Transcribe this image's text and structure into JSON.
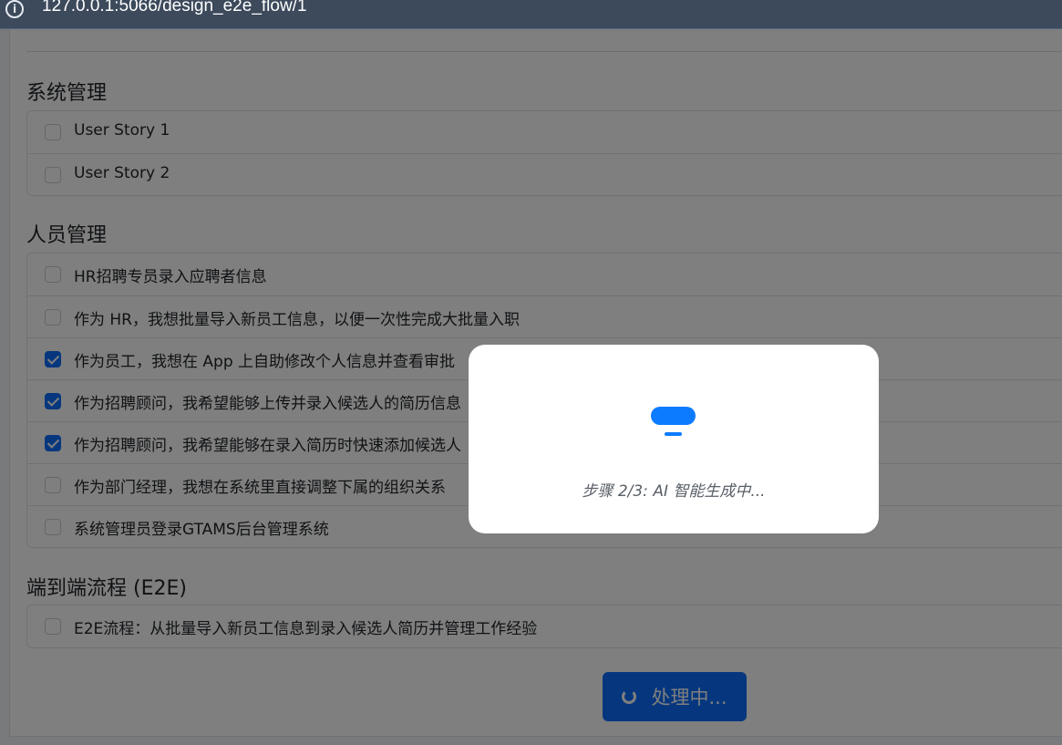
{
  "browser": {
    "url": "127.0.0.1:5066/design_e2e_flow/1"
  },
  "sections": [
    {
      "title": "系统管理",
      "items": [
        {
          "label": "User Story 1",
          "checked": false
        },
        {
          "label": "User Story 2",
          "checked": false
        }
      ]
    },
    {
      "title": "人员管理",
      "items": [
        {
          "label": "HR招聘专员录入应聘者信息",
          "checked": false
        },
        {
          "label": "作为 HR，我想批量导入新员工信息，以便一次性完成大批量入职",
          "checked": false
        },
        {
          "label": "作为员工，我想在 App 上自助修改个人信息并查看审批",
          "checked": true
        },
        {
          "label": "作为招聘顾问，我希望能够上传并录入候选人的简历信息",
          "checked": true
        },
        {
          "label": "作为招聘顾问，我希望能够在录入简历时快速添加候选人",
          "checked": true
        },
        {
          "label": "作为部门经理，我想在系统里直接调整下属的组织关系",
          "checked": false
        },
        {
          "label": "系统管理员登录GTAMS后台管理系统",
          "checked": false
        }
      ]
    },
    {
      "title": "端到端流程 (E2E)",
      "items": [
        {
          "label": "E2E流程：从批量导入新员工信息到录入候选人简历并管理工作经验",
          "checked": false
        }
      ]
    }
  ],
  "submit_button": {
    "label": "处理中..."
  },
  "modal": {
    "status_text": "步骤 2/3: AI 智能生成中..."
  },
  "colors": {
    "primary": "#0d6efd",
    "overlay": "rgba(0,0,0,0.5)"
  }
}
